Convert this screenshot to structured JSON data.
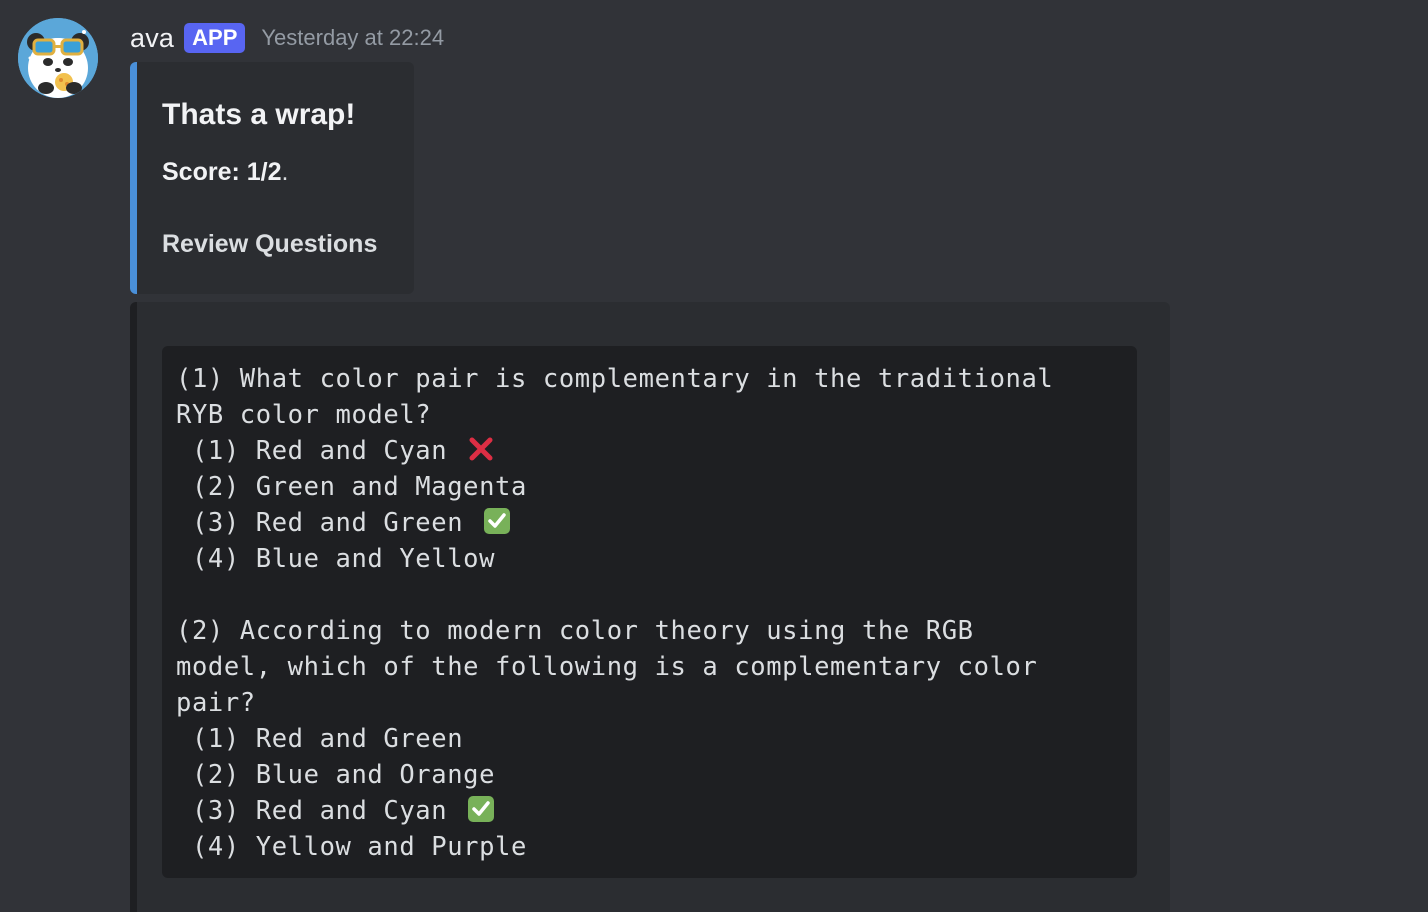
{
  "author": {
    "name": "ava",
    "badge": "APP",
    "timestamp": "Yesterday at 22:24",
    "avatar_icon": "panda-avatar-icon"
  },
  "summary_embed": {
    "accent_color": "#4a90d9",
    "title": "Thats a wrap!",
    "score_label": "Score:",
    "score_value": "1/2",
    "score_suffix": ".",
    "review_heading": "Review Questions"
  },
  "review_embed": {
    "lines": [
      {
        "text": "(1) What color pair is complementary in the traditional",
        "mark": null
      },
      {
        "text": "RYB color model?",
        "mark": null
      },
      {
        "text": " (1) Red and Cyan ",
        "mark": "cross-mark-icon"
      },
      {
        "text": " (2) Green and Magenta",
        "mark": null
      },
      {
        "text": " (3) Red and Green ",
        "mark": "check-mark-icon"
      },
      {
        "text": " (4) Blue and Yellow",
        "mark": null
      },
      {
        "text": "",
        "mark": null
      },
      {
        "text": "(2) According to modern color theory using the RGB",
        "mark": null
      },
      {
        "text": "model, which of the following is a complementary color",
        "mark": null
      },
      {
        "text": "pair?",
        "mark": null
      },
      {
        "text": " (1) Red and Green",
        "mark": null
      },
      {
        "text": " (2) Blue and Orange",
        "mark": null
      },
      {
        "text": " (3) Red and Cyan ",
        "mark": "check-mark-icon"
      },
      {
        "text": " (4) Yellow and Purple",
        "mark": null
      }
    ]
  },
  "colors": {
    "background": "#313338",
    "badge": "#5865f2",
    "cross": "#dd2e44",
    "check": "#78b159"
  }
}
